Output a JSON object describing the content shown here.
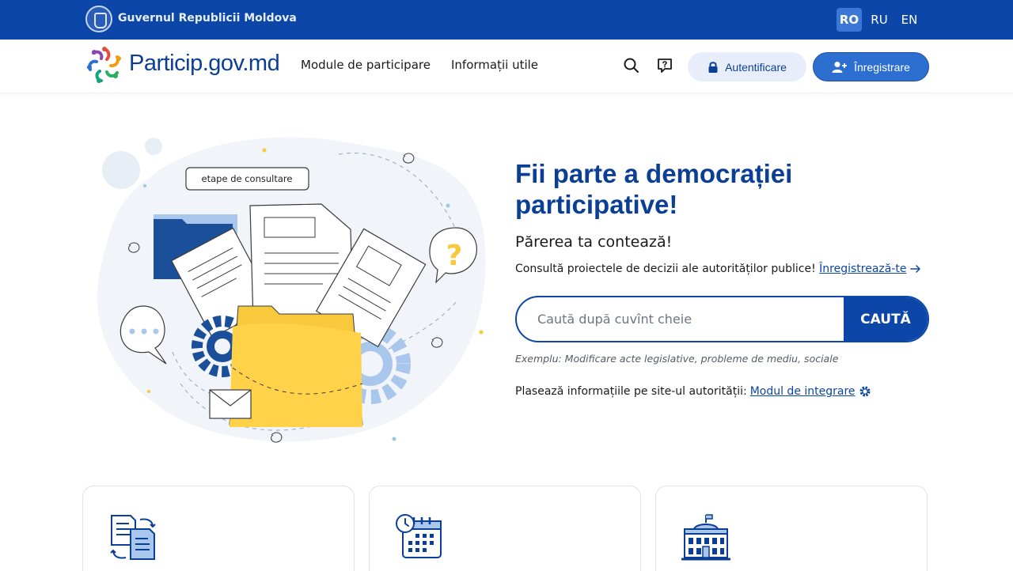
{
  "gov_bar": {
    "name": "Guvernul Republicii Moldova",
    "languages": [
      {
        "code": "RO",
        "active": true
      },
      {
        "code": "RU",
        "active": false
      },
      {
        "code": "EN",
        "active": false
      }
    ]
  },
  "nav": {
    "logo_text": "Particip.gov.md",
    "links": [
      "Module de participare",
      "Informații utile"
    ],
    "login_label": "Autentificare",
    "register_label": "Înregistrare"
  },
  "hero": {
    "art_label": "etape de consultare",
    "title": "Fii parte a democrației participative!",
    "subtitle": "Părerea ta contează!",
    "description": "Consultă proiectele de decizii ale autorităților publice!",
    "register_link": "Înregistrează-te",
    "search_placeholder": "Caută după cuvînt cheie",
    "search_button": "CAUTĂ",
    "example": "Exemplu: Modificare acte legislative, probleme de mediu, sociale",
    "integration_text": "Plasează informațiile pe site-ul autorității:",
    "integration_link": "Modul de integrare"
  },
  "colors": {
    "primary": "#0b46a8",
    "primary_dark": "#0b3f95",
    "accent_yellow": "#f8c93c",
    "light_blue": "#e7eefa"
  },
  "cards": [
    {
      "icon": "documents-exchange-icon"
    },
    {
      "icon": "calendar-clock-icon"
    },
    {
      "icon": "institution-building-icon"
    }
  ]
}
